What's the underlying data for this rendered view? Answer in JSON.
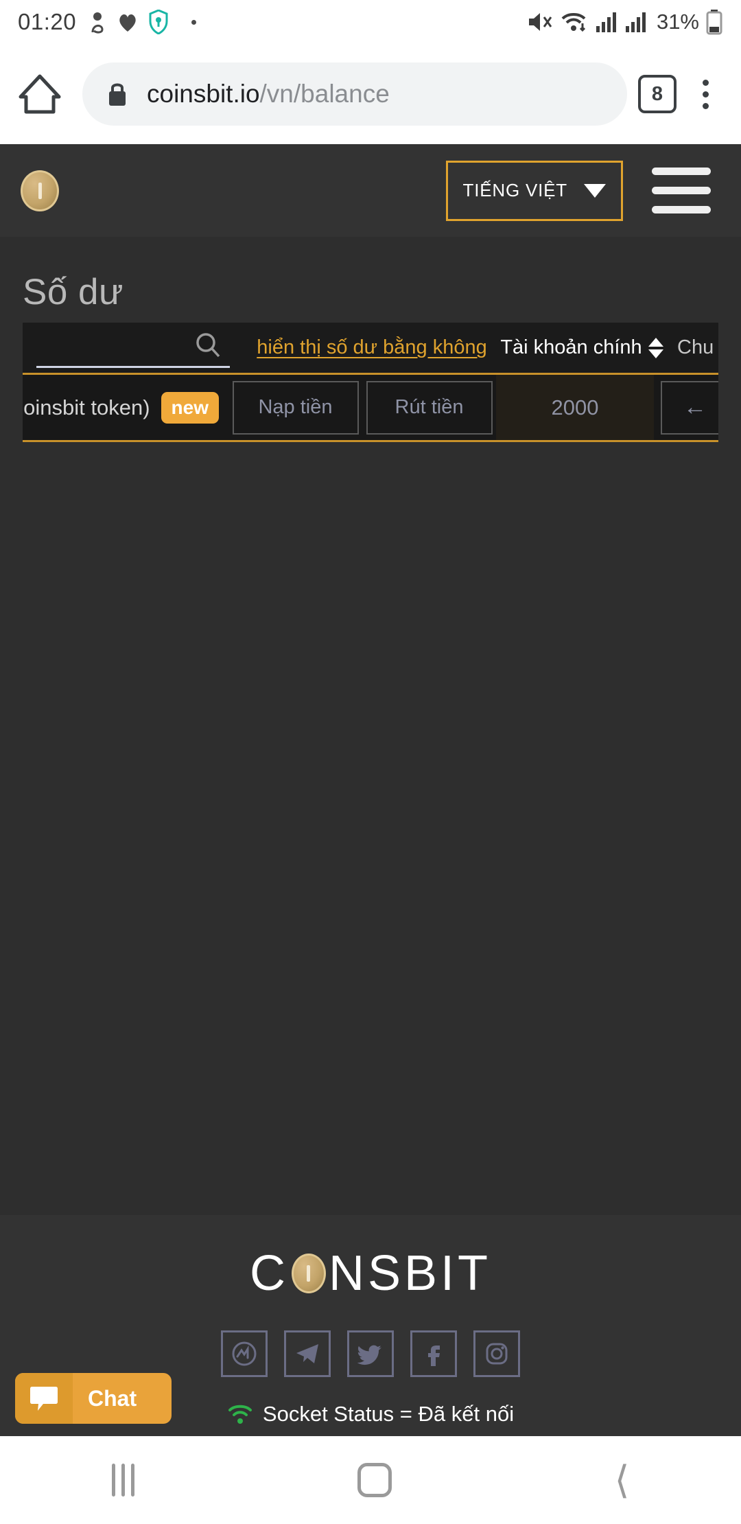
{
  "status_bar": {
    "time": "01:20",
    "battery_percent": "31%",
    "icons": [
      "do-not-disturb-icon",
      "heart-icon",
      "vpn-shield-icon",
      "dot-icon",
      "mute-icon",
      "wifi-icon",
      "signal-1-icon",
      "signal-2-icon",
      "battery-icon"
    ]
  },
  "browser": {
    "home_icon": "home-icon",
    "lock_icon": "lock-icon",
    "url_domain": "coinsbit.io",
    "url_path": "/vn/balance",
    "tab_count": "8",
    "menu_icon": "overflow-menu-icon"
  },
  "site_header": {
    "logo_icon": "coinsbit-coin-logo-icon",
    "language": "TIẾNG VIỆT",
    "language_caret_icon": "chevron-down-icon",
    "menu_icon": "hamburger-menu-icon"
  },
  "page": {
    "title": "Số dư"
  },
  "balance_table": {
    "search_placeholder": "",
    "search_value": "",
    "search_icon": "search-icon",
    "zero_balance_link": "hiển thị số dư bằng không",
    "columns": [
      {
        "label": "Tài khoản chính",
        "sortable": true,
        "sort_icon": "sort-arrows-icon"
      },
      {
        "label": "Chu",
        "sortable": false,
        "sort_icon": ""
      }
    ],
    "rows": [
      {
        "token_name": "Coinsbit token)",
        "badge": "new",
        "deposit_label": "Nạp tiền",
        "withdraw_label": "Rút tiền",
        "main_account_value": "2000",
        "transfer_icon": "arrow-left-icon"
      }
    ]
  },
  "footer": {
    "logo_left": "C",
    "logo_right": "NSBIT",
    "logo_coin_icon": "coinsbit-coin-logo-icon",
    "socials": [
      {
        "name": "coinmarketcap-icon",
        "label": "CoinMarketCap"
      },
      {
        "name": "telegram-icon",
        "label": "Telegram"
      },
      {
        "name": "twitter-icon",
        "label": "Twitter"
      },
      {
        "name": "facebook-icon",
        "label": "Facebook"
      },
      {
        "name": "instagram-icon",
        "label": "Instagram"
      }
    ],
    "socket_status": "Socket Status = Đã kết nối",
    "socket_icon": "wifi-connected-icon"
  },
  "chat_widget": {
    "label": "Chat",
    "icon": "chat-bubble-icon"
  },
  "nav_bar": {
    "recent_icon": "recent-apps-icon",
    "home_icon": "home-square-icon",
    "back_icon": "back-chevron-icon"
  },
  "colors": {
    "accent_gold": "#e0a32e",
    "badge_orange": "#f0a93a",
    "chat_orange": "#e9a33a",
    "page_bg": "#2e2e2e",
    "header_bg": "#333333",
    "table_row_bg": "#181818",
    "socket_green": "#2eb34a"
  }
}
